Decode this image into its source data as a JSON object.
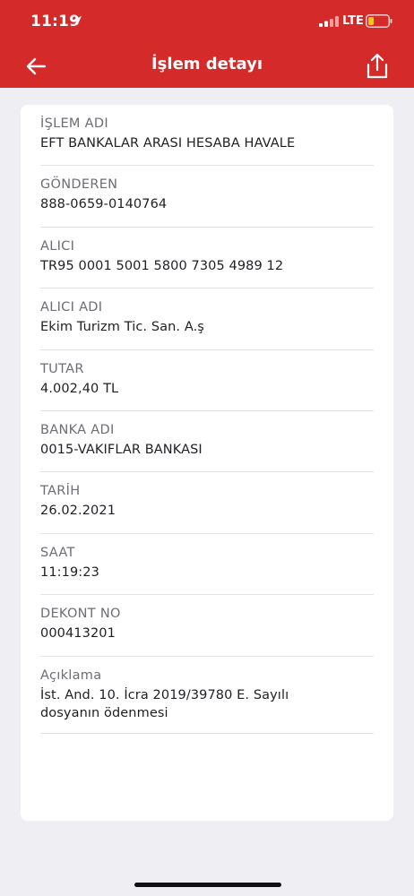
{
  "status": {
    "time": "11:19",
    "network": "LTE"
  },
  "nav": {
    "title": "İşlem detayı"
  },
  "details": [
    {
      "label": "İŞLEM ADI",
      "value": "EFT BANKALAR ARASI HESABA HAVALE"
    },
    {
      "label": "GÖNDEREN",
      "value": "888-0659-0140764"
    },
    {
      "label": "ALICI",
      "value": "TR95 0001 5001 5800 7305 4989 12"
    },
    {
      "label": "ALICI ADI",
      "value": "Ekim Turizm Tic. San. A.ş"
    },
    {
      "label": "TUTAR",
      "value": "4.002,40 TL"
    },
    {
      "label": "BANKA ADI",
      "value": "0015-VAKIFLAR BANKASI"
    },
    {
      "label": "TARİH",
      "value": "26.02.2021"
    },
    {
      "label": "SAAT",
      "value": "11:19:23"
    },
    {
      "label": "DEKONT NO",
      "value": "000413201"
    },
    {
      "label": "Açıklama",
      "value_lines": [
        "İst. And. 10. İcra 2019/39780 E. Sayılı",
        "dosyanın ödenmesi"
      ]
    }
  ],
  "icons": {
    "back": "arrow-left-icon",
    "share": "share-icon",
    "location": "location-arrow-icon",
    "signal": "cellular-signal-icon",
    "battery": "battery-low-icon"
  },
  "colors": {
    "header": "#d42a2a",
    "battery_level": "#f5c518"
  }
}
